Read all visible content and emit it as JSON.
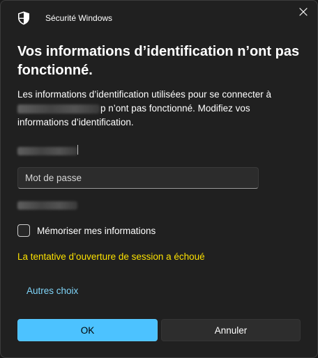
{
  "window": {
    "app_title": "Sécurité Windows",
    "app_icon": "shield-icon",
    "close_icon": "close-icon"
  },
  "dialog": {
    "heading": "Vos informations d’identification n’ont pas fonctionné.",
    "message_part1": "Les informations d’identification utilisées pour se connecter à",
    "message_part2": "p n’ont pas fonctionné. Modifiez vos informations d’identification."
  },
  "form": {
    "password_placeholder": "Mot de passe",
    "remember_label": "Mémoriser mes informations"
  },
  "status": {
    "error_text": "La tentative d’ouverture de session a échoué"
  },
  "links": {
    "more_choices": "Autres choix"
  },
  "buttons": {
    "ok_label": "OK",
    "cancel_label": "Annuler"
  },
  "colors": {
    "background": "#202020",
    "accent": "#4cc2ff",
    "error": "#fce100",
    "link": "#7fd4f8"
  }
}
